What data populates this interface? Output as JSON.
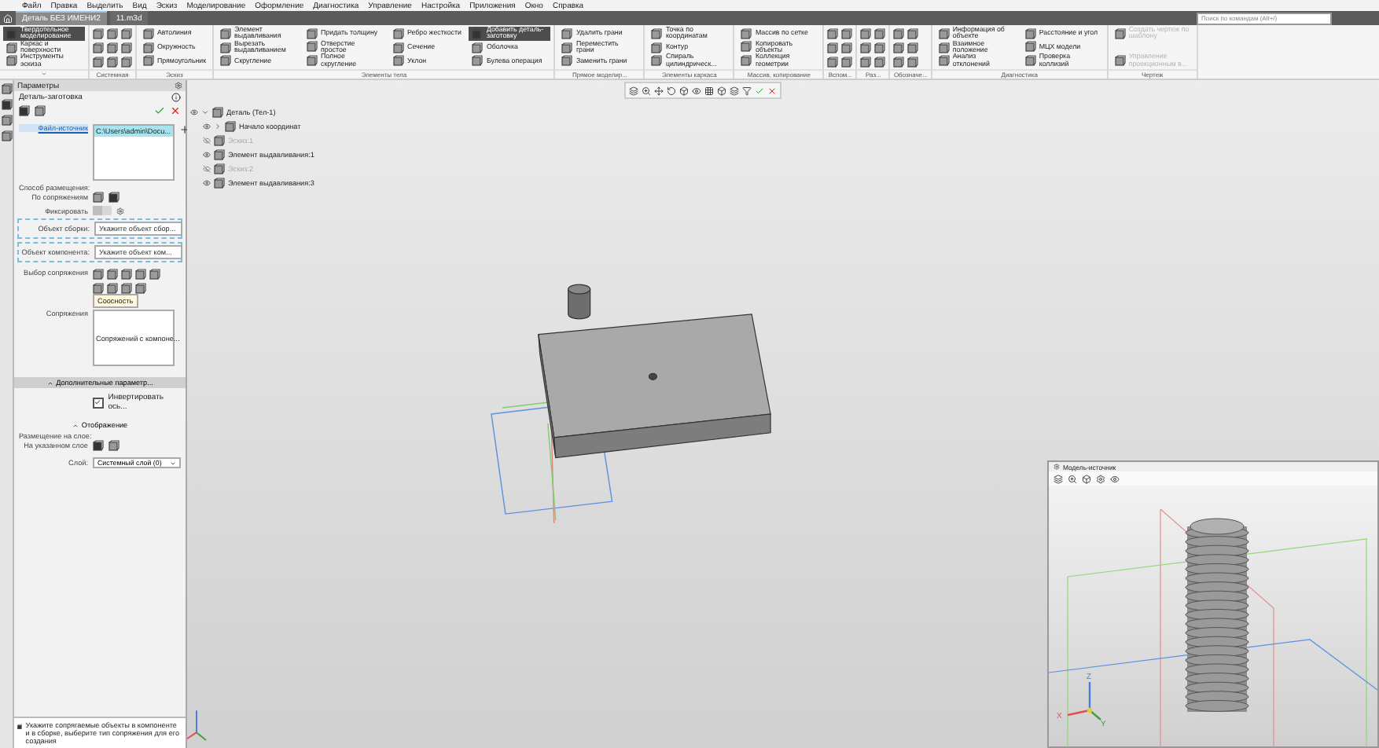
{
  "menu": [
    "Файл",
    "Правка",
    "Выделить",
    "Вид",
    "Эскиз",
    "Моделирование",
    "Оформление",
    "Диагностика",
    "Управление",
    "Настройка",
    "Приложения",
    "Окно",
    "Справка"
  ],
  "tabs": [
    {
      "label": "Деталь БЕЗ ИМЕНИ2",
      "selected": true
    },
    {
      "label": "11.m3d",
      "selected": false
    }
  ],
  "search": {
    "placeholder": "Поиск по командам (Alt+/)"
  },
  "ribbon": {
    "groups": [
      {
        "kind": "commands",
        "items": [
          {
            "label": "Твердотельное моделирование",
            "selected": true,
            "disabled": false
          },
          {
            "label": "Каркас и поверхности",
            "selected": false,
            "disabled": false
          },
          {
            "label": "Инструменты эскиза",
            "selected": false,
            "disabled": false
          }
        ]
      },
      {
        "kind": "icons",
        "label": "Системная"
      },
      {
        "kind": "commands",
        "label": "Эскиз",
        "items": [
          {
            "label": "Автолиния",
            "selected": false,
            "disabled": false
          },
          {
            "label": "Окружность",
            "selected": false,
            "disabled": false
          },
          {
            "label": "Прямоугольник",
            "selected": false,
            "disabled": false
          }
        ]
      },
      {
        "kind": "commands",
        "label": "Элементы тела",
        "items": [
          {
            "label": "Элемент выдавливания",
            "selected": false,
            "disabled": false
          },
          {
            "label": "Вырезать выдавливанием",
            "selected": false,
            "disabled": false
          },
          {
            "label": "Скругление",
            "selected": false,
            "disabled": false
          },
          {
            "label": "Придать толщину",
            "selected": false,
            "disabled": false
          },
          {
            "label": "Отверстие простое",
            "selected": false,
            "disabled": false
          },
          {
            "label": "Полное скругление",
            "selected": false,
            "disabled": false
          },
          {
            "label": "Ребро жесткости",
            "selected": false,
            "disabled": false
          },
          {
            "label": "Сечение",
            "selected": false,
            "disabled": false
          },
          {
            "label": "Уклон",
            "selected": false,
            "disabled": false
          },
          {
            "label": "Добавить деталь-заготовку",
            "selected": true,
            "disabled": false
          },
          {
            "label": "Оболочка",
            "selected": false,
            "disabled": false
          },
          {
            "label": "Булева операция",
            "selected": false,
            "disabled": false
          }
        ]
      },
      {
        "kind": "commands",
        "label": "Прямое моделир...",
        "items": [
          {
            "label": "Удалить грани",
            "selected": false,
            "disabled": false
          },
          {
            "label": "Переместить грани",
            "selected": false,
            "disabled": false
          },
          {
            "label": "Заменить грани",
            "selected": false,
            "disabled": false
          }
        ]
      },
      {
        "kind": "commands",
        "label": "Элементы каркаса",
        "items": [
          {
            "label": "Точка по координатам",
            "selected": false,
            "disabled": false
          },
          {
            "label": "Контур",
            "selected": false,
            "disabled": false
          },
          {
            "label": "Спираль цилиндрическ...",
            "selected": false,
            "disabled": false
          }
        ]
      },
      {
        "kind": "commands",
        "label": "Массив, копирование",
        "items": [
          {
            "label": "Массив по сетке",
            "selected": false,
            "disabled": false
          },
          {
            "label": "Копировать объекты",
            "selected": false,
            "disabled": false
          },
          {
            "label": "Коллекция геометрии",
            "selected": false,
            "disabled": false
          }
        ]
      },
      {
        "kind": "icons",
        "label": "Вспом..."
      },
      {
        "kind": "icons",
        "label": "Раз..."
      },
      {
        "kind": "icons",
        "label": "Обозначе..."
      },
      {
        "kind": "commands",
        "label": "Диагностика",
        "items": [
          {
            "label": "Информация об объекте",
            "selected": false,
            "disabled": false
          },
          {
            "label": "Взаимное положение",
            "selected": false,
            "disabled": false
          },
          {
            "label": "Анализ отклонений",
            "selected": false,
            "disabled": false
          },
          {
            "label": "Расстояние и угол",
            "selected": false,
            "disabled": false
          },
          {
            "label": "МЦХ модели",
            "selected": false,
            "disabled": false
          },
          {
            "label": "Проверка коллизий",
            "selected": false,
            "disabled": false
          }
        ]
      },
      {
        "kind": "commands",
        "label": "Чертеж",
        "items": [
          {
            "label": "Создать чертеж по шаблону",
            "selected": false,
            "disabled": true
          },
          {
            "label": "Управление проекционным в...",
            "selected": false,
            "disabled": true
          }
        ]
      }
    ]
  },
  "panel": {
    "title": "Параметры",
    "subtitle": "Деталь-заготовка",
    "source": {
      "label": "Файл-источник",
      "files": [
        "C:\\Users\\admin\\Docu..."
      ]
    },
    "placement": {
      "label": "Способ размещения:",
      "value": "По сопряжениям"
    },
    "fix": {
      "label": "Фиксировать",
      "on": false
    },
    "fields": [
      {
        "label": "Объект сборки:",
        "placeholder": "Укажите объект сбор..."
      },
      {
        "label": "Объект компонента:",
        "placeholder": "Укажите объект ком..."
      }
    ],
    "mate_choice": {
      "label": "Выбор сопряжения",
      "tooltip": "Соосность"
    },
    "mates": {
      "label": "Сопряжения",
      "items": [
        "Сопряжений с компоне..."
      ]
    },
    "extra": {
      "title": "Дополнительные параметр...",
      "expanded": true,
      "checkbox": {
        "label": "Инвертировать ось...",
        "checked": true
      }
    },
    "display": {
      "title": "Отображение",
      "expanded": true,
      "placement_label": "Размещение на слое:",
      "placement_value": "На указанном слое",
      "layer_label": "Слой:",
      "layer_value": "Системный слой (0)"
    },
    "hint": "Укажите сопрягаемые объекты в компоненте и в сборке, выберите тип сопряжения для его создания"
  },
  "tree": [
    {
      "label": "Деталь (Тел-1)",
      "expanded": true,
      "visible": true,
      "children": [
        {
          "label": "Начало координат",
          "expanded": false,
          "visible": true
        },
        {
          "label": "Эскиз:1",
          "visible": false
        },
        {
          "label": "Элемент выдавливания:1",
          "visible": true
        },
        {
          "label": "Эскиз:2",
          "visible": false
        },
        {
          "label": "Элемент выдавливания:3",
          "visible": true
        }
      ]
    }
  ],
  "inset": {
    "title": "Модель-источник",
    "axis_labels": [
      "X",
      "Y",
      "Z"
    ]
  }
}
